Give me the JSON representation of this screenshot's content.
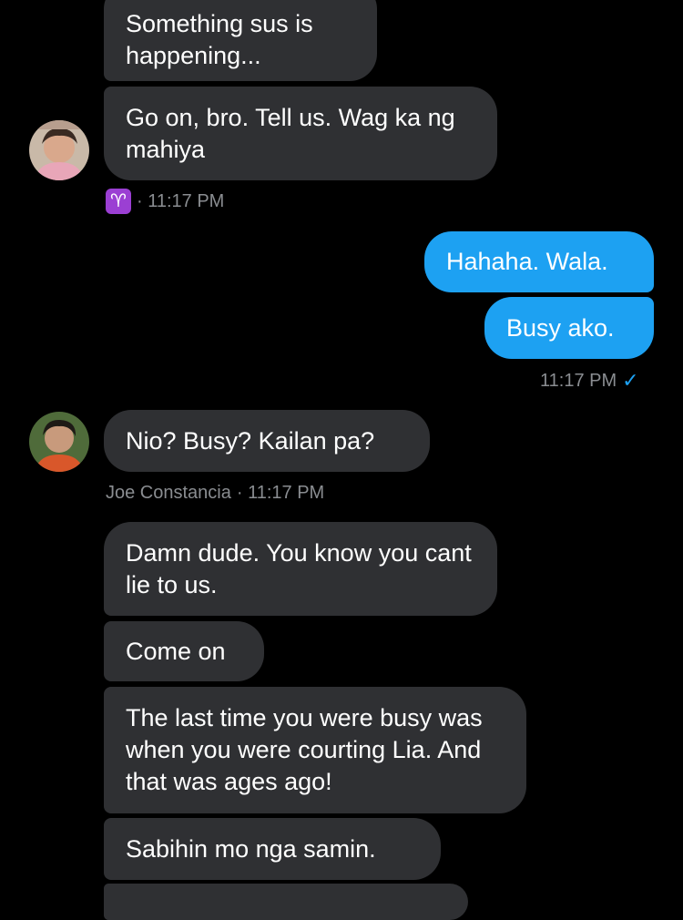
{
  "messages": {
    "m1": "Something sus is happening...",
    "m2": "Go on, bro. Tell us. Wag ka ng mahiya",
    "m3": "Hahaha. Wala.",
    "m4": "Busy ako.",
    "m5": "Nio? Busy? Kailan pa?",
    "m6": "Damn dude. You know you cant lie to us.",
    "m7": "Come on",
    "m8": "The last time you were busy was when you were courting Lia. And that was ages ago!",
    "m9": "Sabihin mo nga samin."
  },
  "meta": {
    "group1_time": "· 11:17 PM",
    "sent_time": "11:17 PM",
    "group2_sender": "Joe Constancia",
    "group2_time": "· 11:17 PM"
  },
  "icons": {
    "aries_glyph": "♈",
    "check": "✓"
  },
  "colors": {
    "background": "#000000",
    "incoming_bubble": "#2f3033",
    "outgoing_bubble": "#1da1f2",
    "meta_text": "#8a8d91",
    "aries_badge": "#9b3fd3"
  }
}
